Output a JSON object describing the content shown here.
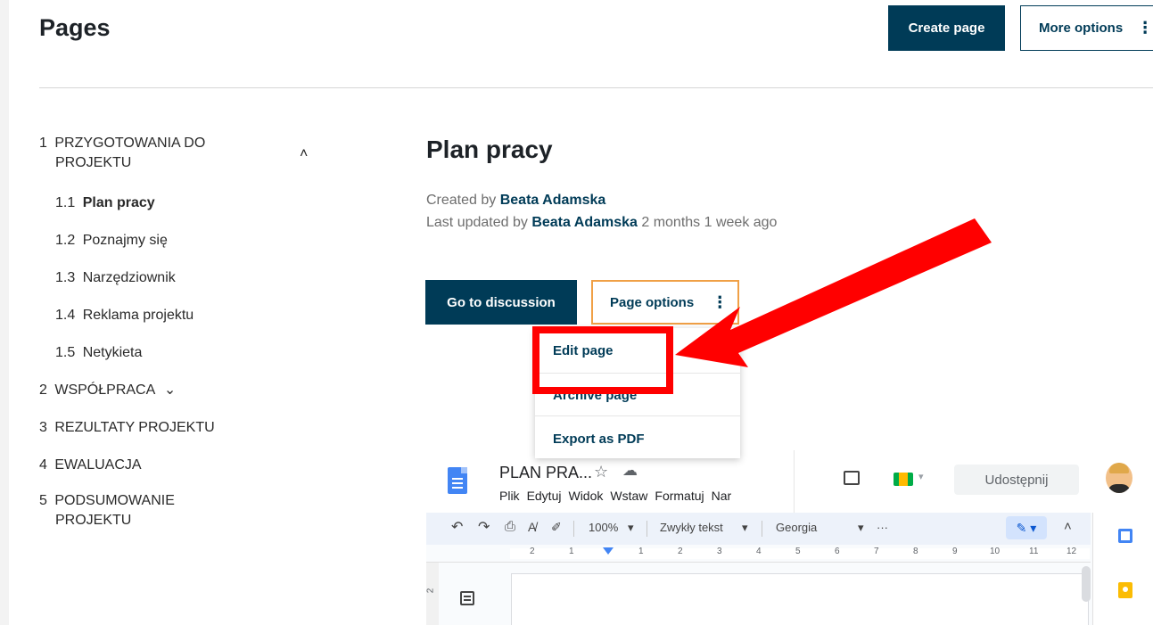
{
  "header": {
    "title": "Pages",
    "create_label": "Create page",
    "more_label": "More options",
    "more_icon": "⋮"
  },
  "nav": {
    "items": [
      {
        "num": "1",
        "label": "PRZYGOTOWANIA DO",
        "label2": "PROJEKTU"
      },
      {
        "num": "1.1",
        "label": "Plan pracy"
      },
      {
        "num": "1.2",
        "label": "Poznajmy się"
      },
      {
        "num": "1.3",
        "label": "Narzędziownik"
      },
      {
        "num": "1.4",
        "label": "Reklama projektu"
      },
      {
        "num": "1.5",
        "label": "Netykieta"
      },
      {
        "num": "2",
        "label": "WSPÓŁPRACA"
      },
      {
        "num": "3",
        "label": "REZULTATY PROJEKTU"
      },
      {
        "num": "4",
        "label": "EWALUACJA"
      },
      {
        "num": "5",
        "label": "PODSUMOWANIE",
        "label2": "PROJEKTU"
      }
    ],
    "collapse_icon": "˄",
    "expand_icon": "⌄"
  },
  "content": {
    "title": "Plan pracy",
    "created_prefix": "Created by",
    "created_by": "Beata Adamska",
    "updated_prefix": "Last updated by",
    "updated_by": "Beata Adamska",
    "updated_suffix": "2 months 1 week ago",
    "discussion_label": "Go to discussion",
    "page_options_label": "Page options",
    "page_options_icon": "⋮"
  },
  "dropdown": {
    "items": [
      "Edit page",
      "Archive page",
      "Export as PDF"
    ]
  },
  "gdoc": {
    "name": "PLAN PRA...",
    "star": "☆",
    "cloud": "☁",
    "menu": [
      "Plik",
      "Edytuj",
      "Widok",
      "Wstaw",
      "Formatuj",
      "Nar"
    ],
    "share_label": "Udostępnij",
    "toolbar": {
      "undo": "↶",
      "redo": "↷",
      "print": "⎙",
      "spell": "A̸",
      "paint": "✐",
      "zoom": "100%",
      "caret": "▾",
      "style": "Zwykły tekst",
      "font": "Georgia",
      "more": "···",
      "pencil": "✎ ▾",
      "collapse": "˄"
    },
    "ruler": [
      "2",
      "1",
      "1",
      "2",
      "3",
      "4",
      "5",
      "6",
      "7",
      "8",
      "9",
      "10",
      "11",
      "12"
    ],
    "vruler": "2"
  },
  "colors": {
    "primary": "#003b57",
    "highlight": "#ff0000",
    "options_border": "#f0a046"
  }
}
